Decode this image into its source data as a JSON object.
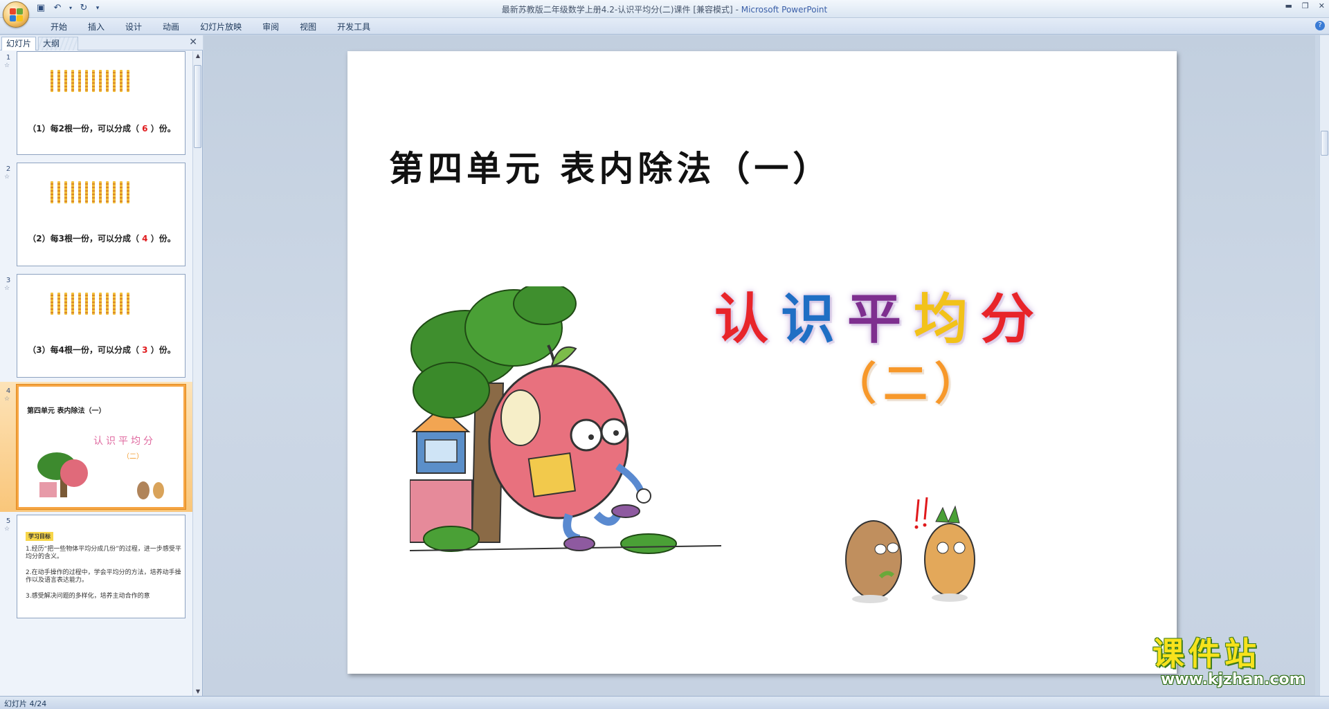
{
  "window": {
    "title": "最新苏教版二年级数学上册4.2-认识平均分(二)课件 [兼容模式]",
    "app_name": "Microsoft PowerPoint",
    "separator": " - "
  },
  "ribbon": {
    "tabs": [
      "开始",
      "插入",
      "设计",
      "动画",
      "幻灯片放映",
      "审阅",
      "视图",
      "开发工具"
    ]
  },
  "panel": {
    "tab_slides": "幻灯片",
    "tab_outline": "大纲",
    "close": "✕"
  },
  "thumbnails": [
    {
      "num": "1",
      "caption_pre": "（1）每2根一份，可以分成（ ",
      "answer": "6",
      "caption_post": " ）份。"
    },
    {
      "num": "2",
      "caption_pre": "（2）每3根一份，可以分成（ ",
      "answer": "4",
      "caption_post": " ）份。"
    },
    {
      "num": "3",
      "caption_pre": "（3）每4根一份，可以分成（ ",
      "answer": "3",
      "caption_post": " ）份。"
    },
    {
      "num": "4",
      "title": "第四单元 表内除法（一）",
      "sub": "认识平均分",
      "sub2": "（二）"
    },
    {
      "num": "5",
      "tag": "学习目标",
      "lines": [
        "1.经历“把一些物体平均分成几份”的过程，进一步感受平均分的含义。",
        "2.在动手操作的过程中，学会平均分的方法，培养动手操作以及语言表达能力。",
        "3.感受解决问题的多样化，培养主动合作的意"
      ]
    }
  ],
  "slide": {
    "unit_title": "第四单元 表内除法（一）",
    "main_title_chars": [
      "认",
      "识",
      "平",
      "均",
      "分"
    ],
    "main_title_colors": [
      "#e8242a",
      "#1f6fc4",
      "#7e2f8f",
      "#f2c21a",
      "#e8242a"
    ],
    "sub_title": "（二）"
  },
  "watermark": {
    "text": "课件站",
    "url": "www.kjzhan.com"
  },
  "status": {
    "slide_counter": "幻灯片 4/24"
  }
}
